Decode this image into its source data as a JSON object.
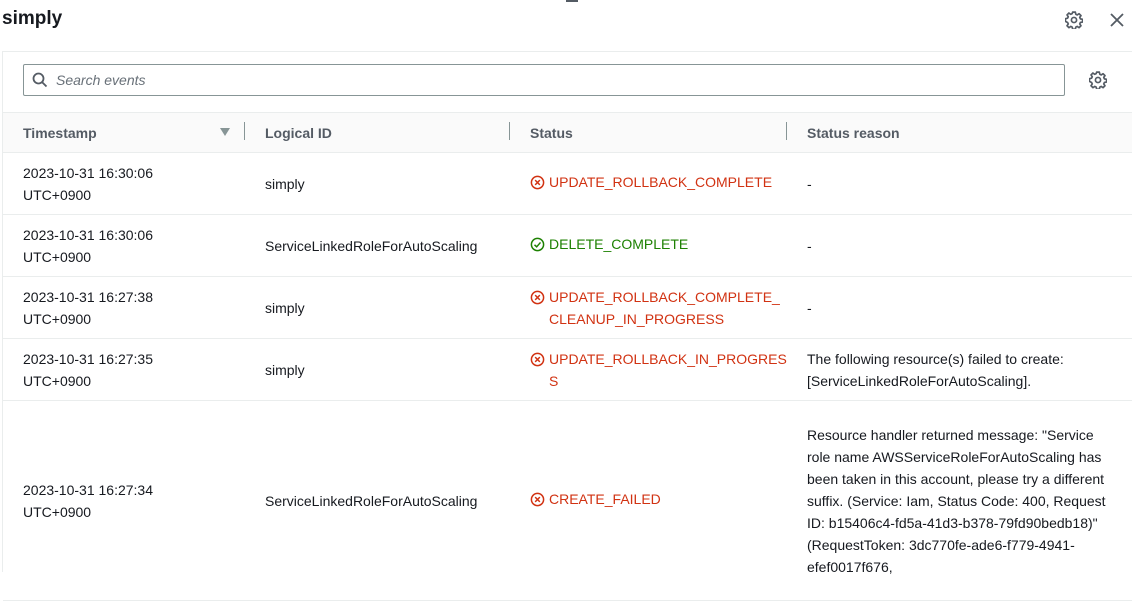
{
  "header": {
    "title": "simply"
  },
  "search": {
    "placeholder": "Search events"
  },
  "colors": {
    "error": "#d13212",
    "success": "#1d8102",
    "header_text": "#545b64",
    "border": "#eaeded"
  },
  "table": {
    "columns": [
      "Timestamp",
      "Logical ID",
      "Status",
      "Status reason"
    ],
    "sort": {
      "column": "Timestamp",
      "direction": "descending",
      "icon": "caret-down-icon"
    },
    "rows": [
      {
        "timestamp": "2023-10-31 16:30:06\nUTC+0900",
        "logical_id": "simply",
        "status": "UPDATE_ROLLBACK_COMPLETE",
        "status_type": "error",
        "status_icon": "error-circle-icon",
        "reason": "-"
      },
      {
        "timestamp": "2023-10-31 16:30:06\nUTC+0900",
        "logical_id": "ServiceLinkedRoleForAutoScaling",
        "status": "DELETE_COMPLETE",
        "status_type": "success",
        "status_icon": "success-check-icon",
        "reason": "-"
      },
      {
        "timestamp": "2023-10-31 16:27:38\nUTC+0900",
        "logical_id": "simply",
        "status": "UPDATE_ROLLBACK_COMPLETE_\nCLEANUP_IN_PROGRESS",
        "status_type": "error",
        "status_icon": "error-circle-icon",
        "reason": "-"
      },
      {
        "timestamp": "2023-10-31 16:27:35\nUTC+0900",
        "logical_id": "simply",
        "status": "UPDATE_ROLLBACK_IN_PROGRES\nS",
        "status_type": "error",
        "status_icon": "error-circle-icon",
        "reason": "The following resource(s) failed to create: [ServiceLinkedRoleForAutoScaling]."
      },
      {
        "timestamp": "2023-10-31 16:27:34\nUTC+0900",
        "logical_id": "ServiceLinkedRoleForAutoScaling",
        "status": "CREATE_FAILED",
        "status_type": "error",
        "status_icon": "error-circle-icon",
        "reason": "Resource handler returned message: \"Service role name AWSServiceRoleForAutoScaling has been taken in this account, please try a different suffix. (Service: Iam, Status Code: 400, Request ID: b15406c4-fd5a-41d3-b378-79fd90bedb18)\" (RequestToken: 3dc770fe-ade6-f779-4941-efef0017f676,"
      }
    ]
  }
}
